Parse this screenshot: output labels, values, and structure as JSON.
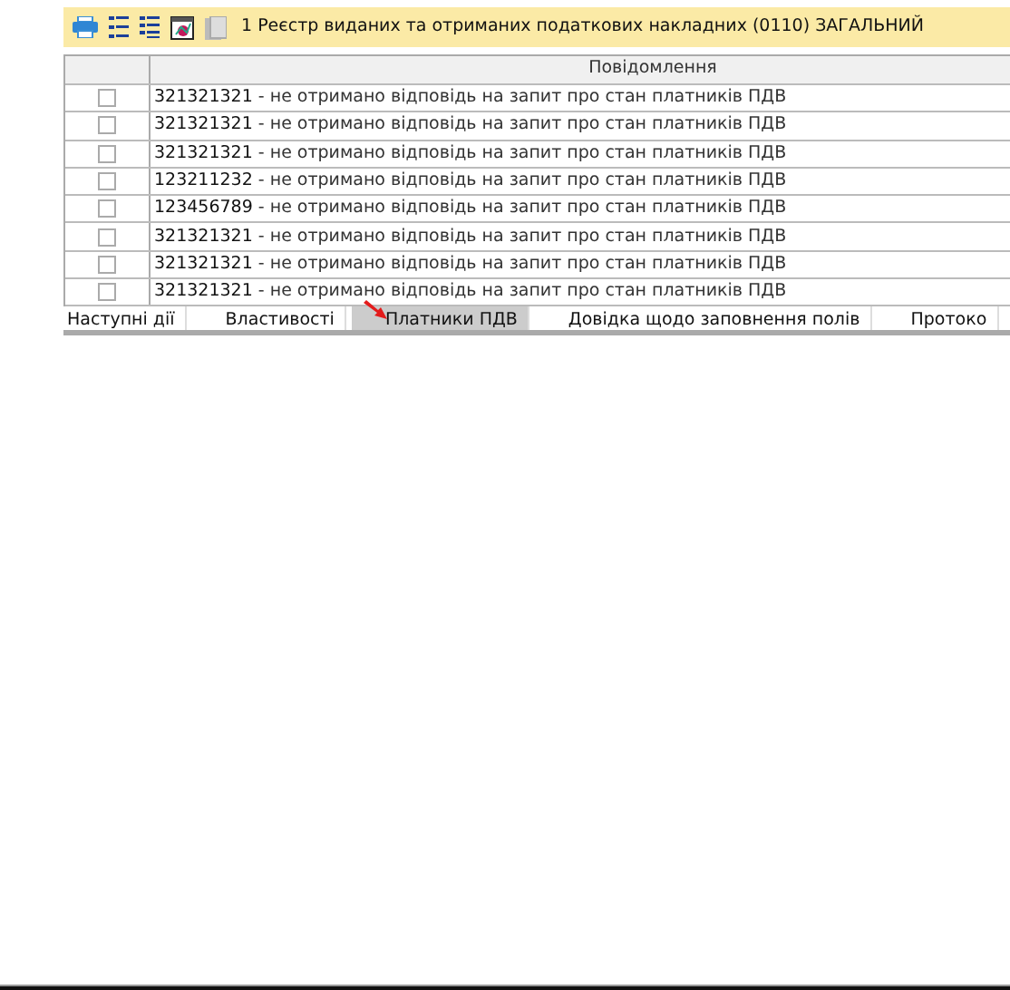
{
  "toolbar": {
    "title": "1 Реєстр виданих та отриманих податкових накладних (0110) ЗАГАЛЬНИЙ"
  },
  "table": {
    "columns": [
      "Повідомлення"
    ],
    "rows": [
      {
        "checked": false,
        "number": "321321321",
        "message": "- не отримано відповідь на запит про стан платників ПДВ"
      },
      {
        "checked": false,
        "number": "321321321",
        "message": "- не отримано відповідь на запит про стан платників ПДВ"
      },
      {
        "checked": false,
        "number": "321321321",
        "message": "- не отримано відповідь на запит про стан платників ПДВ"
      },
      {
        "checked": false,
        "number": "123211232",
        "message": "- не отримано відповідь на запит про стан платників ПДВ"
      },
      {
        "checked": false,
        "number": "123456789",
        "message": "- не отримано відповідь на запит про стан платників ПДВ"
      },
      {
        "checked": false,
        "number": "321321321",
        "message": "- не отримано відповідь на запит про стан платників ПДВ"
      },
      {
        "checked": false,
        "number": "321321321",
        "message": "- не отримано відповідь на запит про стан платників ПДВ"
      },
      {
        "checked": false,
        "number": "321321321",
        "message": "- не отримано відповідь на запит про стан платників ПДВ"
      }
    ]
  },
  "tabs": [
    {
      "label": "Наступні дії",
      "selected": false
    },
    {
      "label": "Властивості",
      "selected": false
    },
    {
      "label": "Платники ПДВ",
      "selected": true
    },
    {
      "label": "Довідка щодо заповнення полів",
      "selected": false
    },
    {
      "label": "Протоко",
      "selected": false
    }
  ]
}
